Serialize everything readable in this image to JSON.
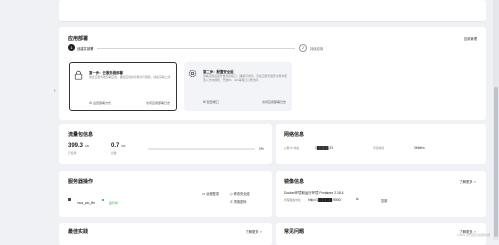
{
  "deploy": {
    "title": "应用部署",
    "manage_label": "应用管理",
    "steps": [
      {
        "number": "1",
        "label": "创建并部署"
      },
      {
        "number": "2",
        "label": "持续应用"
      }
    ],
    "card1": {
      "title": "第一步：云服务器部署",
      "desc": "通过云服务器部署应用，确定应用的可用性与规模，快速部署上线",
      "action_left": "设置部署方式",
      "action_right": "访问应用部署日志"
    },
    "card2": {
      "title": "第二步：配置安全组",
      "desc": "部署应用后需开放对应端口，确保可访问。可在云服务器安全组中配置入方向规则，开放80、443等端口以便访问",
      "action_left": "配置端口",
      "action_right": "访问应用部署日志"
    }
  },
  "traffic": {
    "title": "流量包信息",
    "used_value": "399.3",
    "used_unit": "GB",
    "used_label": "已使用",
    "total_value": "0.7",
    "total_unit": "GB",
    "total_label": "总量",
    "progress_label": "0%",
    "progress_fraction": 0.0
  },
  "network": {
    "title": "网络信息",
    "public_ip_label": "公网 IP 地址",
    "public_ip_value": "1█████.33",
    "bandwidth_label": "带宽峰值",
    "bandwidth_value": "3Mbit/s"
  },
  "server": {
    "title": "服务器操作",
    "instance_name": "hua_wo_ffn",
    "status": "运行中",
    "actions": [
      "远程登录",
      "修改安全组",
      "重置密码"
    ]
  },
  "image": {
    "title": "镜像信息",
    "detail_link": "了解更多",
    "line1": "Docker环境和运行环境 Portainer 2.18.4",
    "line2_label": "管理面板地址",
    "line2_value": "http://1██████:9000/",
    "copy_label": "复制"
  },
  "best_practice": {
    "title": "最佳实践",
    "link": "了解更多"
  },
  "faq": {
    "title": "常见问题",
    "link": "了解更多"
  },
  "watermark": "CSDN @轻量应用服务器"
}
